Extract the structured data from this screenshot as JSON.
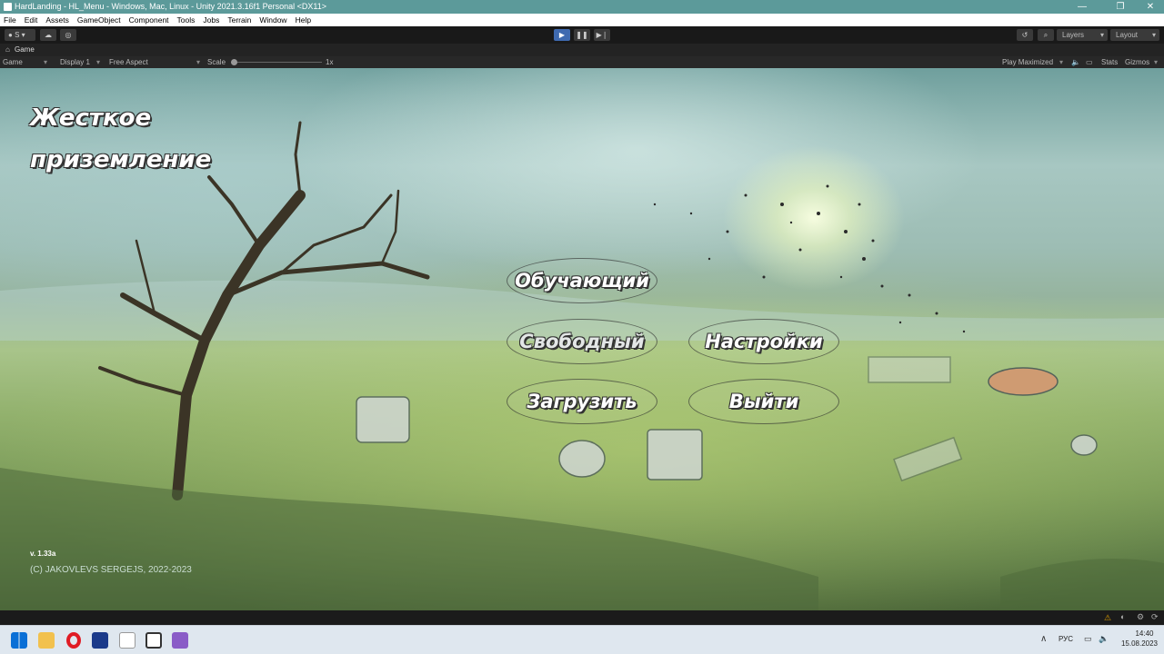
{
  "window": {
    "title": "HardLanding - HL_Menu - Windows, Mac, Linux - Unity 2021.3.16f1 Personal <DX11>",
    "controls": [
      "—",
      "❐",
      "✕"
    ]
  },
  "menu": [
    "File",
    "Edit",
    "Assets",
    "GameObject",
    "Component",
    "Tools",
    "Jobs",
    "Terrain",
    "Window",
    "Help"
  ],
  "toolbar": {
    "account_label": "S",
    "layers_label": "Layers",
    "layout_label": "Layout"
  },
  "game_tab": {
    "label": "Game"
  },
  "game_bar": {
    "view_label": "Game",
    "display_label": "Display 1",
    "aspect_label": "Free Aspect",
    "scale_label": "Scale",
    "scale_value": "1x",
    "play_mode_label": "Play Maximized",
    "stats_label": "Stats",
    "gizmos_label": "Gizmos"
  },
  "game": {
    "title_line1": "Жесткое",
    "title_line2": "приземление",
    "buttons": {
      "tutorial": "Обучающий",
      "free": "Свободный",
      "settings": "Настройки",
      "load": "Загрузить",
      "exit": "Выйти"
    },
    "version": "v. 1.33a",
    "copyright": "(C) JAKOVLEVS SERGEJS, 2022-2023"
  },
  "taskbar": {
    "language": "РУС",
    "time": "14:40",
    "date": "15.08.2023"
  },
  "colors": {
    "titlebar": "#5c9a9a",
    "editor_dark": "#191919",
    "play_accent": "#3f6ab0",
    "taskbar": "#dfe7ef"
  }
}
